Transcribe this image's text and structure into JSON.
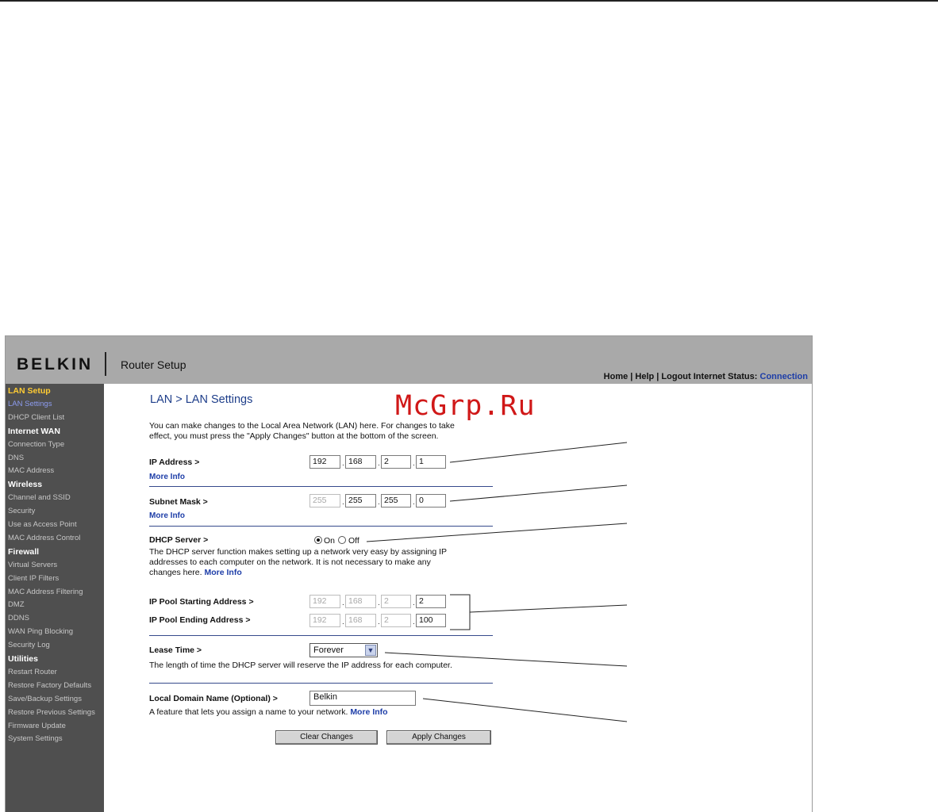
{
  "brand": {
    "logo": "BELKIN",
    "title": "Router Setup"
  },
  "toplinks": {
    "text": "Home | Help | Logout    Internet Status:",
    "status": "Connection"
  },
  "sidebar": [
    {
      "label": "LAN Setup",
      "type": "head-active"
    },
    {
      "label": "LAN Settings",
      "type": "selected"
    },
    {
      "label": "DHCP Client List",
      "type": "item"
    },
    {
      "label": "Internet WAN",
      "type": "head"
    },
    {
      "label": "Connection Type",
      "type": "item"
    },
    {
      "label": "DNS",
      "type": "item"
    },
    {
      "label": "MAC Address",
      "type": "item"
    },
    {
      "label": "Wireless",
      "type": "head"
    },
    {
      "label": "Channel and SSID",
      "type": "item"
    },
    {
      "label": "Security",
      "type": "item"
    },
    {
      "label": "Use as Access Point",
      "type": "item"
    },
    {
      "label": "MAC Address Control",
      "type": "item"
    },
    {
      "label": "Firewall",
      "type": "head"
    },
    {
      "label": "Virtual Servers",
      "type": "item"
    },
    {
      "label": "Client IP Filters",
      "type": "item"
    },
    {
      "label": "MAC Address Filtering",
      "type": "item"
    },
    {
      "label": "DMZ",
      "type": "item"
    },
    {
      "label": "DDNS",
      "type": "item"
    },
    {
      "label": "WAN Ping Blocking",
      "type": "item"
    },
    {
      "label": "Security Log",
      "type": "item"
    },
    {
      "label": "Utilities",
      "type": "head"
    },
    {
      "label": "Restart Router",
      "type": "item"
    },
    {
      "label": "Restore Factory Defaults",
      "type": "item"
    },
    {
      "label": "Save/Backup Settings",
      "type": "item"
    },
    {
      "label": "Restore Previous Settings",
      "type": "item"
    },
    {
      "label": "Firmware Update",
      "type": "item"
    },
    {
      "label": "System Settings",
      "type": "item"
    }
  ],
  "page": {
    "title": "LAN > LAN Settings",
    "intro": "You can make changes to the Local Area Network (LAN) here. For changes to take effect, you must press the \"Apply Changes\" button at the bottom of the screen.",
    "more_info": "More Info"
  },
  "ip": {
    "label": "IP Address >",
    "o": [
      "192",
      "168",
      "2",
      "1"
    ]
  },
  "mask": {
    "label": "Subnet Mask >",
    "o": [
      "255",
      "255",
      "255",
      "0"
    ]
  },
  "dhcp": {
    "label": "DHCP Server  >",
    "on": "On",
    "off": "Off",
    "desc1": "The DHCP server function makes setting up a network very easy by assigning IP",
    "desc2": "addresses to each computer on the network. It is not necessary to make any",
    "desc3": "changes here.",
    "more": "More Info"
  },
  "pool_start": {
    "label": "IP Pool Starting Address >",
    "o": [
      "192",
      "168",
      "2",
      "2"
    ]
  },
  "pool_end": {
    "label": "IP Pool Ending Address >",
    "o": [
      "192",
      "168",
      "2",
      "100"
    ]
  },
  "lease": {
    "label": "Lease Time >",
    "value": "Forever",
    "desc": "The length of time the DHCP server will reserve the IP address for each computer."
  },
  "domain": {
    "label": "Local Domain Name  (Optional) >",
    "value": "Belkin",
    "desc": "A feature that lets you assign a name to your network.",
    "more": "More Info"
  },
  "buttons": {
    "clear": "Clear Changes",
    "apply": "Apply Changes"
  },
  "watermark": "McGrp.Ru"
}
